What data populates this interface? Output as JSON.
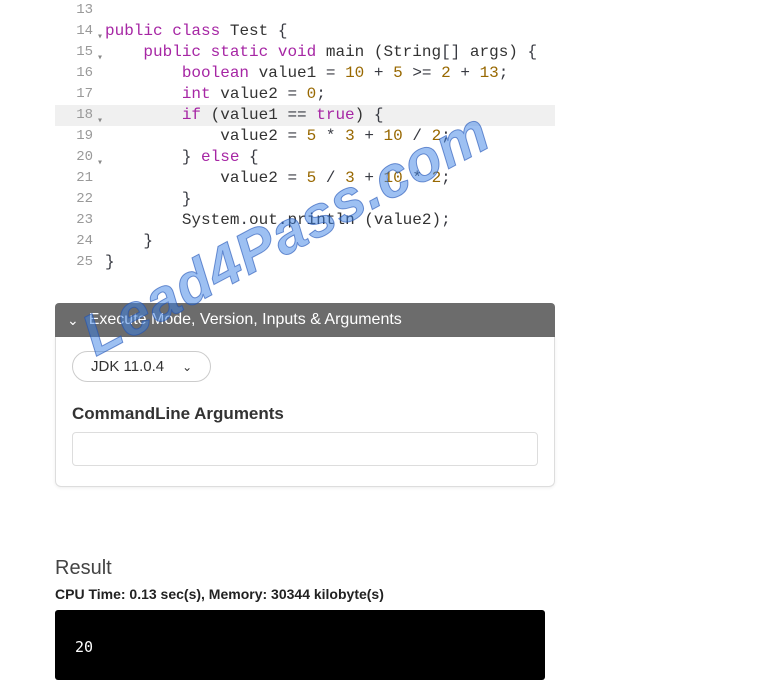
{
  "code": {
    "lines": [
      {
        "num": "13",
        "fold": "",
        "hl": false,
        "tokens": []
      },
      {
        "num": "14",
        "fold": "▾",
        "hl": false,
        "tokens": [
          {
            "c": "kw",
            "t": "public"
          },
          {
            "c": "",
            "t": " "
          },
          {
            "c": "kw",
            "t": "class"
          },
          {
            "c": "",
            "t": " "
          },
          {
            "c": "cls",
            "t": "Test"
          },
          {
            "c": "",
            "t": " "
          },
          {
            "c": "brace",
            "t": "{"
          }
        ]
      },
      {
        "num": "15",
        "fold": "▾",
        "hl": false,
        "tokens": [
          {
            "c": "",
            "t": "    "
          },
          {
            "c": "kw",
            "t": "public"
          },
          {
            "c": "",
            "t": " "
          },
          {
            "c": "kw",
            "t": "static"
          },
          {
            "c": "",
            "t": " "
          },
          {
            "c": "kw",
            "t": "void"
          },
          {
            "c": "",
            "t": " "
          },
          {
            "c": "ident",
            "t": "main"
          },
          {
            "c": "",
            "t": " ("
          },
          {
            "c": "cls",
            "t": "String"
          },
          {
            "c": "brace",
            "t": "[]"
          },
          {
            "c": "",
            "t": " "
          },
          {
            "c": "ident",
            "t": "args"
          },
          {
            "c": "",
            "t": ") "
          },
          {
            "c": "brace",
            "t": "{"
          }
        ]
      },
      {
        "num": "16",
        "fold": "",
        "hl": false,
        "tokens": [
          {
            "c": "",
            "t": "        "
          },
          {
            "c": "kw",
            "t": "boolean"
          },
          {
            "c": "",
            "t": " "
          },
          {
            "c": "ident",
            "t": "value1"
          },
          {
            "c": "",
            "t": " "
          },
          {
            "c": "op",
            "t": "="
          },
          {
            "c": "",
            "t": " "
          },
          {
            "c": "num",
            "t": "10"
          },
          {
            "c": "",
            "t": " "
          },
          {
            "c": "op",
            "t": "+"
          },
          {
            "c": "",
            "t": " "
          },
          {
            "c": "num",
            "t": "5"
          },
          {
            "c": "",
            "t": " "
          },
          {
            "c": "op",
            "t": ">="
          },
          {
            "c": "",
            "t": " "
          },
          {
            "c": "num",
            "t": "2"
          },
          {
            "c": "",
            "t": " "
          },
          {
            "c": "op",
            "t": "+"
          },
          {
            "c": "",
            "t": " "
          },
          {
            "c": "num",
            "t": "13"
          },
          {
            "c": "op",
            "t": ";"
          }
        ]
      },
      {
        "num": "17",
        "fold": "",
        "hl": false,
        "tokens": [
          {
            "c": "",
            "t": "        "
          },
          {
            "c": "kw",
            "t": "int"
          },
          {
            "c": "",
            "t": " "
          },
          {
            "c": "ident",
            "t": "value2"
          },
          {
            "c": "",
            "t": " "
          },
          {
            "c": "op",
            "t": "="
          },
          {
            "c": "",
            "t": " "
          },
          {
            "c": "num",
            "t": "0"
          },
          {
            "c": "op",
            "t": ";"
          }
        ]
      },
      {
        "num": "18",
        "fold": "▾",
        "hl": true,
        "tokens": [
          {
            "c": "",
            "t": "        "
          },
          {
            "c": "kw",
            "t": "if"
          },
          {
            "c": "",
            "t": " ("
          },
          {
            "c": "ident",
            "t": "value1"
          },
          {
            "c": "",
            "t": " "
          },
          {
            "c": "op",
            "t": "=="
          },
          {
            "c": "",
            "t": " "
          },
          {
            "c": "bool",
            "t": "true"
          },
          {
            "c": "",
            "t": ") "
          },
          {
            "c": "brace",
            "t": "{"
          }
        ]
      },
      {
        "num": "19",
        "fold": "",
        "hl": false,
        "tokens": [
          {
            "c": "",
            "t": "            "
          },
          {
            "c": "ident",
            "t": "value2"
          },
          {
            "c": "",
            "t": " "
          },
          {
            "c": "op",
            "t": "="
          },
          {
            "c": "",
            "t": " "
          },
          {
            "c": "num",
            "t": "5"
          },
          {
            "c": "",
            "t": " "
          },
          {
            "c": "op",
            "t": "*"
          },
          {
            "c": "",
            "t": " "
          },
          {
            "c": "num",
            "t": "3"
          },
          {
            "c": "",
            "t": " "
          },
          {
            "c": "op",
            "t": "+"
          },
          {
            "c": "",
            "t": " "
          },
          {
            "c": "num",
            "t": "10"
          },
          {
            "c": "",
            "t": " "
          },
          {
            "c": "op",
            "t": "/"
          },
          {
            "c": "",
            "t": " "
          },
          {
            "c": "num",
            "t": "2"
          },
          {
            "c": "op",
            "t": ";"
          }
        ]
      },
      {
        "num": "20",
        "fold": "▾",
        "hl": false,
        "tokens": [
          {
            "c": "",
            "t": "        "
          },
          {
            "c": "brace",
            "t": "}"
          },
          {
            "c": "",
            "t": " "
          },
          {
            "c": "kw",
            "t": "else"
          },
          {
            "c": "",
            "t": " "
          },
          {
            "c": "brace",
            "t": "{"
          }
        ]
      },
      {
        "num": "21",
        "fold": "",
        "hl": false,
        "tokens": [
          {
            "c": "",
            "t": "            "
          },
          {
            "c": "ident",
            "t": "value2"
          },
          {
            "c": "",
            "t": " "
          },
          {
            "c": "op",
            "t": "="
          },
          {
            "c": "",
            "t": " "
          },
          {
            "c": "num",
            "t": "5"
          },
          {
            "c": "",
            "t": " "
          },
          {
            "c": "op",
            "t": "/"
          },
          {
            "c": "",
            "t": " "
          },
          {
            "c": "num",
            "t": "3"
          },
          {
            "c": "",
            "t": " "
          },
          {
            "c": "op",
            "t": "+"
          },
          {
            "c": "",
            "t": " "
          },
          {
            "c": "num",
            "t": "10"
          },
          {
            "c": "",
            "t": " "
          },
          {
            "c": "op",
            "t": "*"
          },
          {
            "c": "",
            "t": " "
          },
          {
            "c": "num",
            "t": "2"
          },
          {
            "c": "op",
            "t": ";"
          }
        ]
      },
      {
        "num": "22",
        "fold": "",
        "hl": false,
        "tokens": [
          {
            "c": "",
            "t": "        "
          },
          {
            "c": "brace",
            "t": "}"
          }
        ]
      },
      {
        "num": "23",
        "fold": "",
        "hl": false,
        "tokens": [
          {
            "c": "",
            "t": "        "
          },
          {
            "c": "sys",
            "t": "System"
          },
          {
            "c": "op",
            "t": "."
          },
          {
            "c": "ident",
            "t": "out"
          },
          {
            "c": "op",
            "t": "."
          },
          {
            "c": "ident",
            "t": "println"
          },
          {
            "c": "",
            "t": " ("
          },
          {
            "c": "ident",
            "t": "value2"
          },
          {
            "c": "",
            "t": ")"
          },
          {
            "c": "op",
            "t": ";"
          }
        ]
      },
      {
        "num": "24",
        "fold": "",
        "hl": false,
        "tokens": [
          {
            "c": "",
            "t": "    "
          },
          {
            "c": "brace",
            "t": "}"
          }
        ]
      },
      {
        "num": "25",
        "fold": "",
        "hl": false,
        "tokens": [
          {
            "c": "brace",
            "t": "}"
          }
        ]
      }
    ]
  },
  "accordion": {
    "title": "Execute Mode, Version, Inputs & Arguments"
  },
  "jdk": {
    "selected": "JDK 11.0.4"
  },
  "cmdline": {
    "label": "CommandLine Arguments",
    "value": ""
  },
  "result": {
    "label": "Result",
    "stats": "CPU Time: 0.13 sec(s), Memory: 30344 kilobyte(s)",
    "output": "20"
  },
  "watermark": "Lead4Pass.com"
}
